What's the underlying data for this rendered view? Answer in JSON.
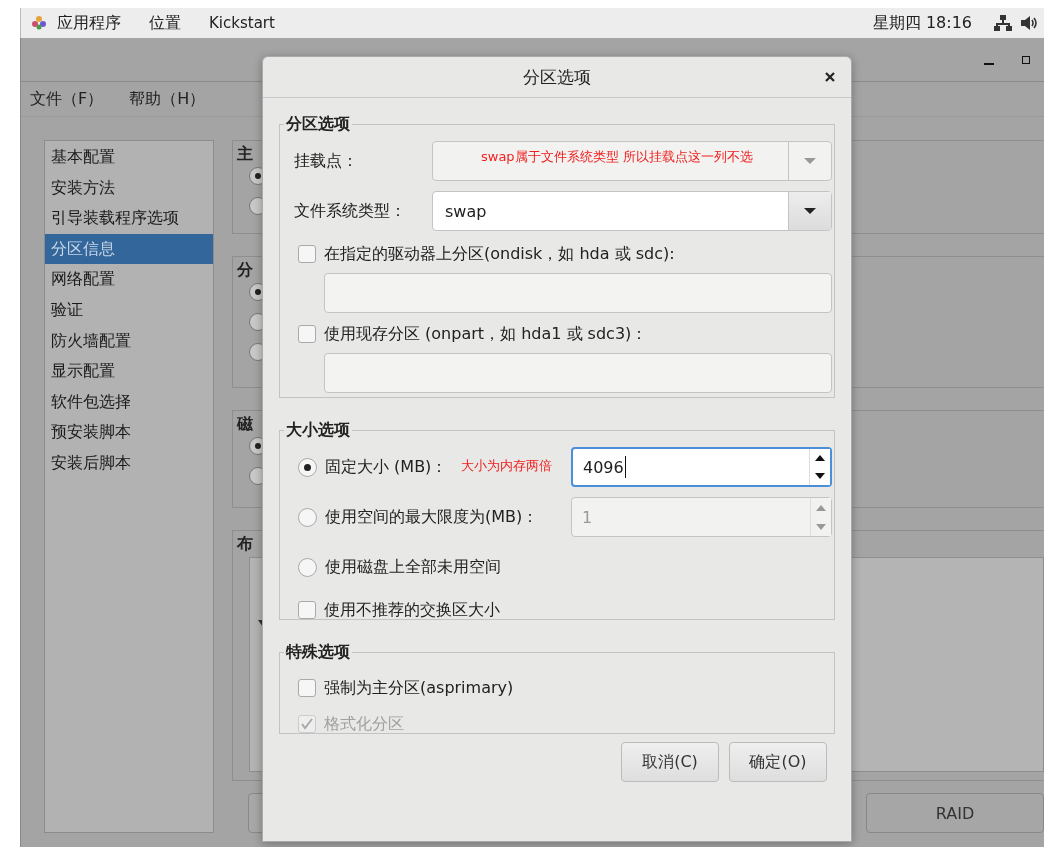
{
  "top_bar": {
    "menus": [
      "应用程序",
      "位置",
      "Kickstart"
    ],
    "clock": "星期四 18:16"
  },
  "main_window": {
    "menu": [
      "文件（F）",
      "帮助（H）"
    ],
    "sidebar": [
      {
        "label": "基本配置",
        "selected": false
      },
      {
        "label": "安装方法",
        "selected": false
      },
      {
        "label": "引导装载程序选项",
        "selected": false
      },
      {
        "label": "分区信息",
        "selected": true
      },
      {
        "label": "网络配置",
        "selected": false
      },
      {
        "label": "验证",
        "selected": false
      },
      {
        "label": "防火墙配置",
        "selected": false
      },
      {
        "label": "显示配置",
        "selected": false
      },
      {
        "label": "软件包选择",
        "selected": false
      },
      {
        "label": "预安装脚本",
        "selected": false
      },
      {
        "label": "安装后脚本",
        "selected": false
      }
    ],
    "sections": [
      {
        "heading": "主",
        "radios": [
          {
            "selected": true
          },
          {
            "selected": false
          }
        ]
      },
      {
        "heading": "分",
        "radios": [
          {
            "selected": true
          },
          {
            "selected": false
          },
          {
            "selected": false
          }
        ]
      },
      {
        "heading": "磁",
        "radios": [
          {
            "selected": true
          },
          {
            "selected": false
          }
        ]
      },
      {
        "heading": "布"
      }
    ],
    "raid_button": "RAID"
  },
  "dialog": {
    "title": "分区选项",
    "partition_options": {
      "heading": "分区选项",
      "mount_point": {
        "label": "挂载点：",
        "annotation": "swap属于文件系统类型  所以挂载点这一列不选",
        "disabled": true
      },
      "fs_type": {
        "label": "文件系统类型：",
        "value": "swap",
        "disabled": false
      },
      "checks": [
        {
          "label": "在指定的驱动器上分区(ondisk，如  hda 或  sdc):",
          "checked": false
        },
        {
          "label": "使用现存分区 (onpart，如  hda1 或  sdc3)：",
          "checked": false
        }
      ]
    },
    "size_options": {
      "heading": "大小选项",
      "rows": [
        {
          "kind": "radio",
          "label": "固定大小 (MB)：",
          "selected": true,
          "annotation": "大小为内存两倍",
          "spin": {
            "value": "4096",
            "disabled": false
          }
        },
        {
          "kind": "radio",
          "label": "使用空间的最大限度为(MB)：",
          "selected": false,
          "spin": {
            "value": "1",
            "disabled": true
          }
        },
        {
          "kind": "radio",
          "label": "使用磁盘上全部未用空间",
          "selected": false
        },
        {
          "kind": "check",
          "label": "使用不推荐的交换区大小",
          "checked": false
        }
      ]
    },
    "special_options": {
      "heading": "特殊选项",
      "checks": [
        {
          "label": "强制为主分区(asprimary)",
          "checked": false,
          "disabled": false
        },
        {
          "label": "格式化分区",
          "checked": true,
          "disabled": true
        }
      ]
    },
    "buttons": [
      "取消(C)",
      "确定(O)"
    ]
  }
}
